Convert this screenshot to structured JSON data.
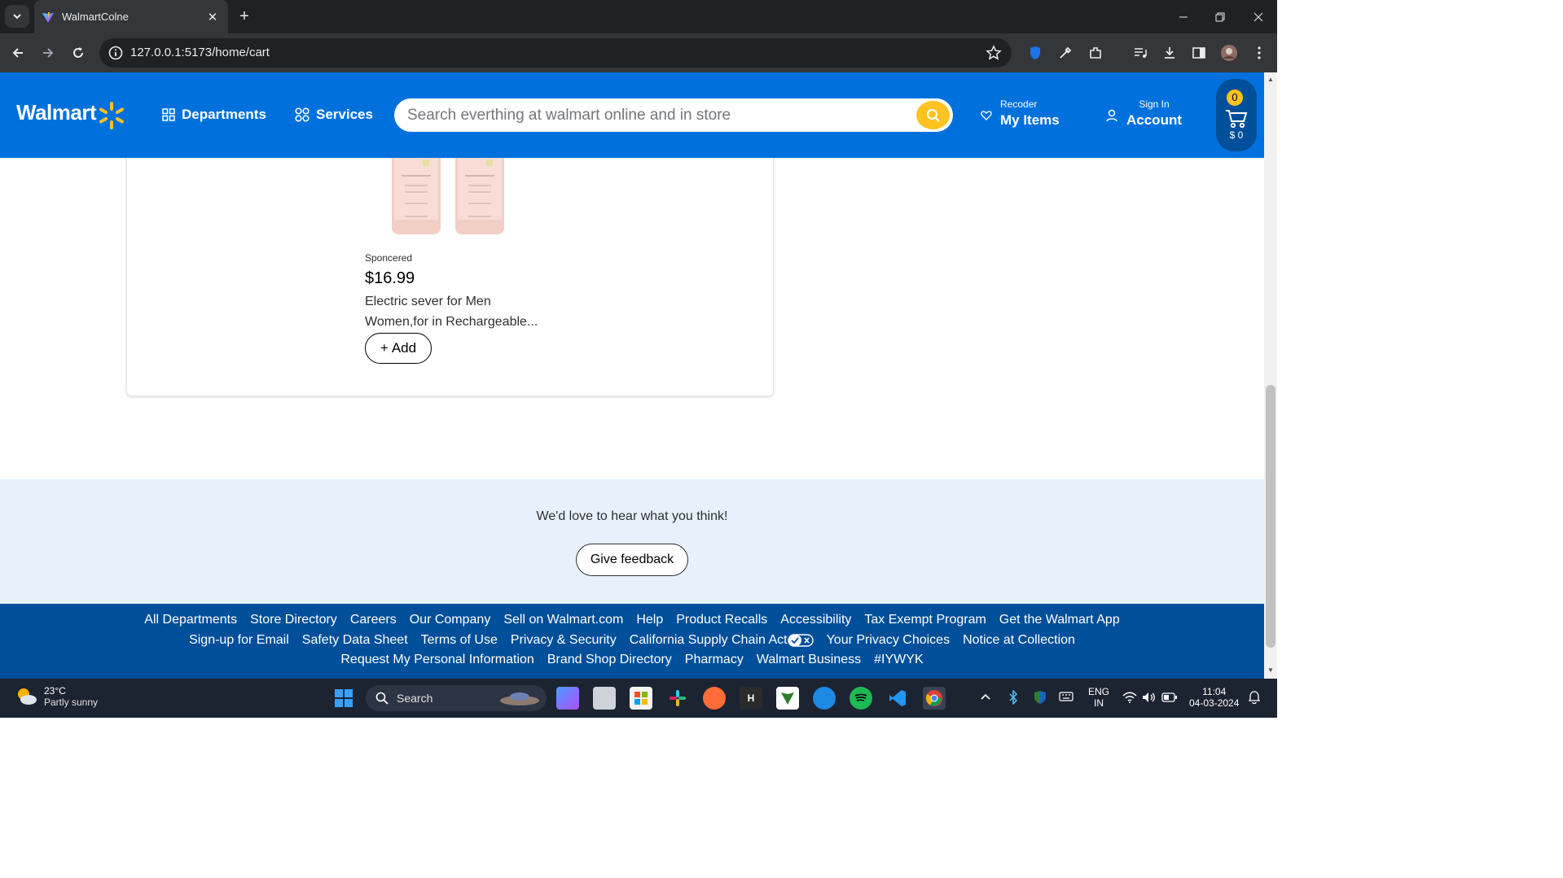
{
  "browser": {
    "tab_title": "WalmartColne",
    "url": "127.0.0.1:5173/home/cart"
  },
  "header": {
    "logo_text": "Walmart",
    "departments_label": "Departments",
    "services_label": "Services",
    "search_placeholder": "Search everthing at walmart online and in store",
    "reorder_small": "Recoder",
    "reorder_big": "My Items",
    "signin_small": "Sign In",
    "signin_big": "Account",
    "cart_count": "0",
    "cart_total": "$ 0"
  },
  "product": {
    "sponsored_label": "Sponcered",
    "price": "$16.99",
    "name": "Electric sever for Men Women,for in Rechargeable...",
    "add_label": "Add"
  },
  "feedback": {
    "message": "We'd love to hear what you think!",
    "button_label": "Give feedback"
  },
  "footer": {
    "row1": [
      "All Departments",
      "Store Directory",
      "Careers",
      "Our Company",
      "Sell on Walmart.com",
      "Help",
      "Product Recalls",
      "Accessibility",
      "Tax Exempt Program",
      "Get the Walmart App"
    ],
    "row2": [
      "Sign-up for Email",
      "Safety Data Sheet",
      "Terms of Use",
      "Privacy & Security",
      "California Supply Chain Act",
      "Your Privacy Choices",
      "Notice at Collection"
    ],
    "row3": [
      "Request My Personal Information",
      "Brand Shop Directory",
      "Pharmacy",
      "Walmart Business",
      "#IYWYK"
    ]
  },
  "taskbar": {
    "temperature": "23°C",
    "weather": "Partly sunny",
    "search_label": "Search",
    "lang_top": "ENG",
    "lang_bottom": "IN",
    "time": "11:04",
    "date": "04-03-2024"
  },
  "colors": {
    "walmart_blue": "#0071dc",
    "walmart_dark_blue": "#004f9a",
    "walmart_yellow": "#ffc220",
    "feedback_bg": "#e6f1fc"
  }
}
